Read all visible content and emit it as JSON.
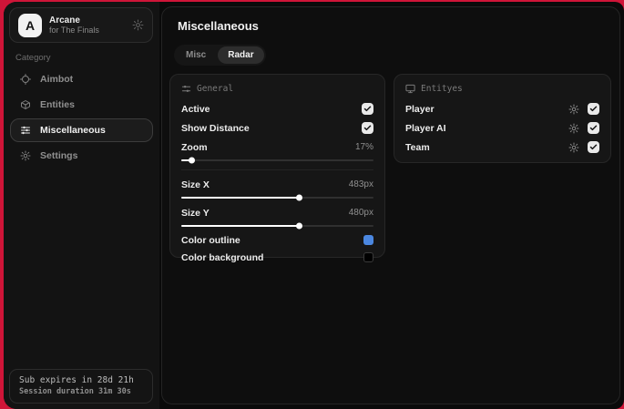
{
  "app": {
    "name": "Arcane",
    "subtitle": "for The Finals",
    "avatar_letter": "A"
  },
  "sidebar": {
    "category_label": "Category",
    "items": [
      {
        "label": "Aimbot",
        "icon": "crosshair-icon",
        "active": false
      },
      {
        "label": "Entities",
        "icon": "cube-icon",
        "active": false
      },
      {
        "label": "Miscellaneous",
        "icon": "sliders-icon",
        "active": true
      },
      {
        "label": "Settings",
        "icon": "gear-icon",
        "active": false
      }
    ],
    "footer": {
      "sub_expires": "Sub expires in 28d 21h",
      "session_duration": "Session duration 31m 30s"
    }
  },
  "main": {
    "title": "Miscellaneous",
    "tabs": [
      {
        "label": "Misc",
        "active": false
      },
      {
        "label": "Radar",
        "active": true
      }
    ],
    "general_card": {
      "title": "General",
      "icon": "sliders-icon",
      "toggles": [
        {
          "label": "Active",
          "checked": true
        },
        {
          "label": "Show Distance",
          "checked": true
        }
      ],
      "sliders": [
        {
          "label": "Zoom",
          "value": "17%",
          "percent": 5
        },
        {
          "label": "Size X",
          "value": "483px",
          "percent": 61
        },
        {
          "label": "Size Y",
          "value": "480px",
          "percent": 61
        }
      ],
      "colors": [
        {
          "label": "Color outline",
          "swatch": "#4b87e0"
        },
        {
          "label": "Color background",
          "swatch": "#000000"
        }
      ]
    },
    "entities_card": {
      "title": "Entityes",
      "icon": "monitor-icon",
      "rows": [
        {
          "label": "Player",
          "checked": true
        },
        {
          "label": "Player AI",
          "checked": true
        },
        {
          "label": "Team",
          "checked": true
        }
      ]
    }
  },
  "colors": {
    "backdrop_red": "#cf1538",
    "outline_blue": "#4b87e0",
    "background_swatch": "#000000"
  }
}
